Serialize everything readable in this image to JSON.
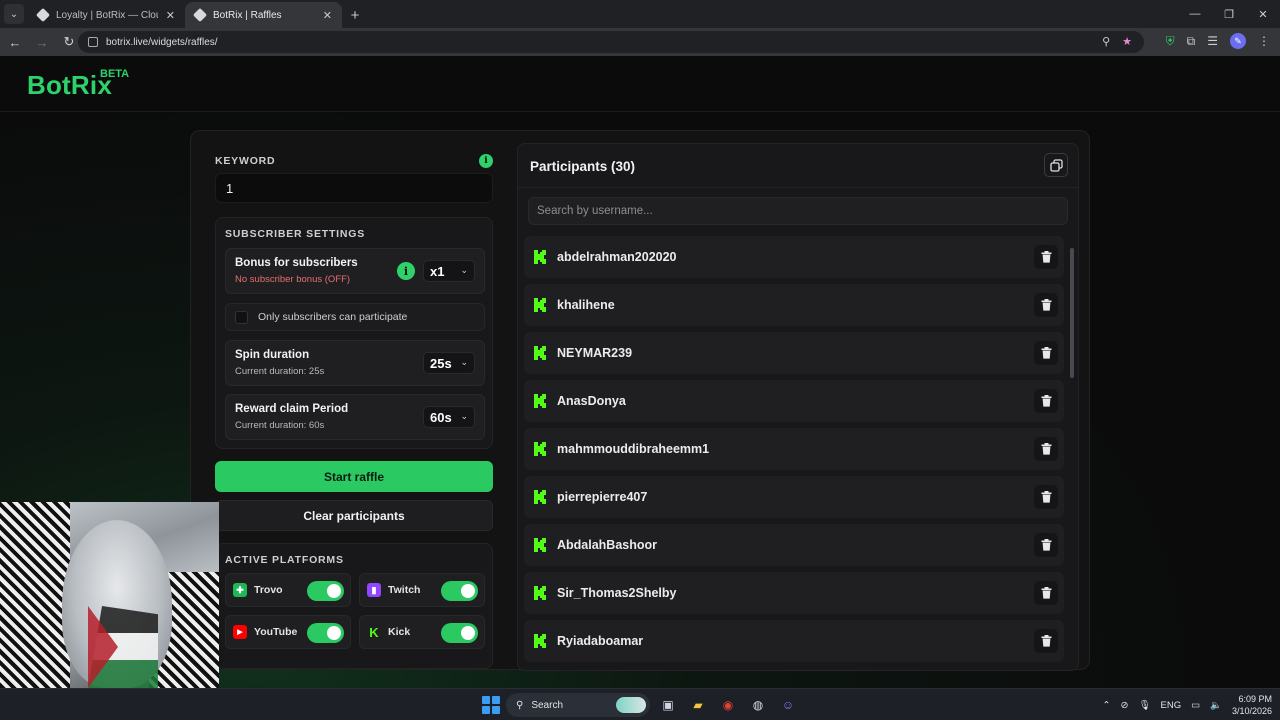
{
  "browser": {
    "tabs": [
      {
        "title": "Loyalty | BotRix — Cloud Stream",
        "active": false
      },
      {
        "title": "BotRix | Raffles",
        "active": true
      }
    ],
    "url": "botrix.live/widgets/raffles/"
  },
  "header": {
    "logo": "BotRix",
    "badge": "BETA"
  },
  "keyword": {
    "label": "KEYWORD",
    "value": "1"
  },
  "subscriber_settings": {
    "title": "SUBSCRIBER SETTINGS",
    "bonus": {
      "title": "Bonus for subscribers",
      "subtitle": "No subscriber bonus (OFF)",
      "value": "x1"
    },
    "only_subs": {
      "label": "Only subscribers can participate",
      "checked": false
    },
    "spin": {
      "title": "Spin duration",
      "subtitle": "Current duration: 25s",
      "value": "25s"
    },
    "claim": {
      "title": "Reward claim Period",
      "subtitle": "Current duration: 60s",
      "value": "60s"
    }
  },
  "buttons": {
    "start": "Start raffle",
    "clear": "Clear participants"
  },
  "platforms": {
    "title": "ACTIVE PLATFORMS",
    "items": [
      {
        "label": "Trovo",
        "icon": "trovo-icon",
        "color": "#1db954",
        "enabled": true
      },
      {
        "label": "Twitch",
        "icon": "twitch-icon",
        "color": "#9146ff",
        "enabled": true
      },
      {
        "label": "YouTube",
        "icon": "youtube-icon",
        "color": "#ff0000",
        "enabled": true
      },
      {
        "label": "Kick",
        "icon": "kick-icon",
        "color": "#53fc18",
        "enabled": true
      }
    ]
  },
  "participants": {
    "title": "Participants (30)",
    "search_placeholder": "Search by username...",
    "items": [
      "abdelrahman202020",
      "khalihene",
      "NEYMAR239",
      "AnasDonya",
      "mahmmouddibraheemm1",
      "pierrepierre407",
      "AbdalahBashoor",
      "Sir_Thomas2Shelby",
      "Ryiadaboamar"
    ]
  },
  "taskbar": {
    "search": "Search",
    "lang": "ENG",
    "time": "6:09 PM",
    "date": "3/10/2026"
  },
  "colors": {
    "accent": "#2bc962",
    "kick": "#53fc18",
    "background": "#0b0b0c"
  }
}
